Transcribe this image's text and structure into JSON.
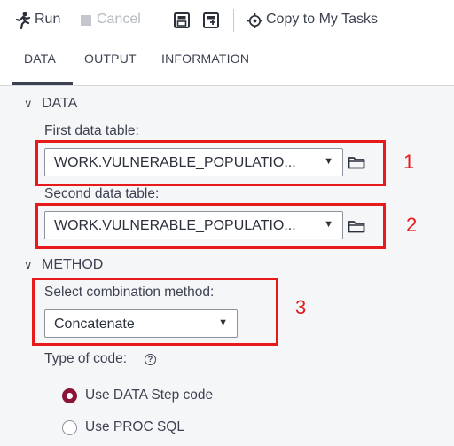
{
  "toolbar": {
    "run_label": "Run",
    "cancel_label": "Cancel",
    "copy_label": "Copy to My Tasks"
  },
  "tabs": [
    {
      "label": "DATA",
      "active": true
    },
    {
      "label": "OUTPUT",
      "active": false
    },
    {
      "label": "INFORMATION",
      "active": false
    }
  ],
  "data_section": {
    "title": "DATA",
    "first_label": "First data table:",
    "first_value": "WORK.VULNERABLE_POPULATIO...",
    "second_label": "Second data table:",
    "second_value": "WORK.VULNERABLE_POPULATIO..."
  },
  "method_section": {
    "title": "METHOD",
    "combo_label": "Select combination method:",
    "combo_value": "Concatenate",
    "type_label": "Type of code:",
    "options": [
      {
        "label": "Use DATA Step code",
        "selected": true
      },
      {
        "label": "Use PROC SQL",
        "selected": false
      }
    ]
  },
  "annotations": [
    "1",
    "2",
    "3"
  ],
  "colors": {
    "annotation": "#e8191a",
    "radio_selected": "#8a1538",
    "panel_bg": "#f5f6f8"
  },
  "icons": [
    "run-icon",
    "stop-icon",
    "save-icon",
    "save-as-icon",
    "copy-icon",
    "folder-icon",
    "help-icon",
    "chevron-down-icon"
  ]
}
